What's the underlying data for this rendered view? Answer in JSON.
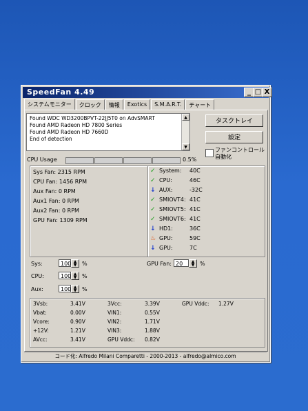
{
  "window": {
    "title": "SpeedFan 4.49",
    "controls": {
      "minimize": "_",
      "maximize": "□",
      "close": "X"
    }
  },
  "tabs": [
    {
      "label": "システムモニター",
      "active": true
    },
    {
      "label": "クロック",
      "active": false
    },
    {
      "label": "情報",
      "active": false
    },
    {
      "label": "Exotics",
      "active": false
    },
    {
      "label": "S.M.A.R.T.",
      "active": false
    },
    {
      "label": "チャート",
      "active": false
    }
  ],
  "log": {
    "lines": [
      "Found WDC WD3200BPVT-22JJ5T0 on AdvSMART",
      "Found AMD Radeon HD 7800 Series",
      "Found AMD Radeon HD 7660D",
      "End of detection"
    ]
  },
  "buttons": {
    "minimize_to_tray": "タスクトレイ",
    "configure": "設定"
  },
  "auto_fan": {
    "label": "ファンコントロール自動化",
    "checked": false
  },
  "cpu_usage": {
    "label": "CPU Usage",
    "percent": "0.5%"
  },
  "fans": [
    {
      "label": "Sys Fan:",
      "value": "2315 RPM"
    },
    {
      "label": "CPU Fan:",
      "value": "1456 RPM"
    },
    {
      "label": "Aux Fan:",
      "value": "0 RPM"
    },
    {
      "label": "Aux1 Fan:",
      "value": "0 RPM"
    },
    {
      "label": "Aux2 Fan:",
      "value": "0 RPM"
    },
    {
      "label": "GPU Fan:",
      "value": "1309 RPM"
    }
  ],
  "temps": [
    {
      "label": "System:",
      "value": "40C",
      "icon": "check-icon"
    },
    {
      "label": "CPU:",
      "value": "46C",
      "icon": "check-icon"
    },
    {
      "label": "AUX:",
      "value": "-32C",
      "icon": "arrow-down-icon"
    },
    {
      "label": "SMIOVT4:",
      "value": "41C",
      "icon": "check-icon"
    },
    {
      "label": "SMIOVT5:",
      "value": "41C",
      "icon": "check-icon"
    },
    {
      "label": "SMIOVT6:",
      "value": "41C",
      "icon": "check-icon"
    },
    {
      "label": "HD1:",
      "value": "36C",
      "icon": "arrow-down-icon"
    },
    {
      "label": "GPU:",
      "value": "59C",
      "icon": "flame-icon"
    },
    {
      "label": "GPU:",
      "value": "7C",
      "icon": "arrow-down-icon"
    }
  ],
  "speeds": {
    "sys": {
      "label": "Sys:",
      "value": "100",
      "unit": "%"
    },
    "cpu": {
      "label": "CPU:",
      "value": "100",
      "unit": "%"
    },
    "aux": {
      "label": "Aux:",
      "value": "100",
      "unit": "%"
    },
    "gpu_fan": {
      "label": "GPU Fan:",
      "value": "20",
      "unit": "%"
    }
  },
  "voltages": {
    "col1": [
      {
        "label": "3Vsb:",
        "value": "3.41V"
      },
      {
        "label": "Vbat:",
        "value": "0.00V"
      },
      {
        "label": "Vcore:",
        "value": "0.90V"
      },
      {
        "label": "+12V:",
        "value": "1.21V"
      },
      {
        "label": "AVcc:",
        "value": "3.41V"
      }
    ],
    "col2": [
      {
        "label": "3Vcc:",
        "value": "3.39V"
      },
      {
        "label": "VIN1:",
        "value": "0.55V"
      },
      {
        "label": "VIN2:",
        "value": "1.71V"
      },
      {
        "label": "VIN3:",
        "value": "1.88V"
      },
      {
        "label": "GPU Vddc:",
        "value": "0.82V"
      }
    ],
    "col3": [
      {
        "label": "GPU Vddc:",
        "value": "1.27V"
      }
    ]
  },
  "credit": "コード化: Alfredo Milani Comparetti - 2000-2013 - alfredo@almico.com",
  "colors": {
    "ok": "#1a9c1a",
    "low": "#1c3ccc",
    "hot": "#e2581a",
    "title_bar": "#0a246a"
  }
}
